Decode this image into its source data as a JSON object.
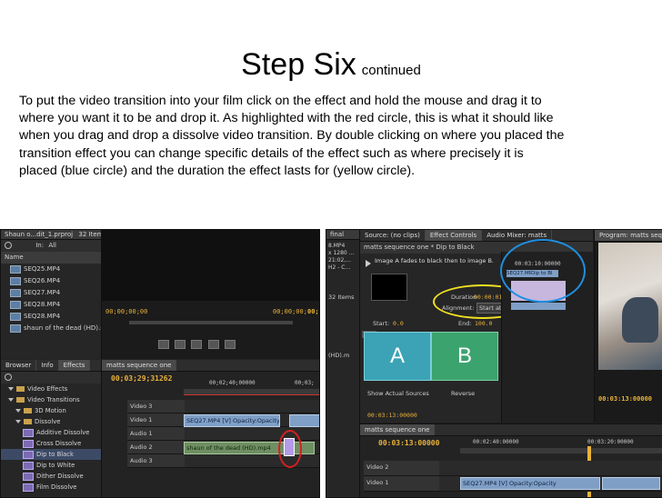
{
  "slide": {
    "title": "Step Six",
    "title_suffix": "continued",
    "body": "To put the video transition into your film click on the effect and hold the mouse and drag it to where you want it to be and drop it. As highlighted with the red circle, this is what it should like when you drag and drop a dissolve video transition. By double clicking on where you placed the transition effect you can change specific details of the effect such as where precisely it is placed (blue circle) and the duration the effect lasts for (yellow circle)."
  },
  "left_shot": {
    "project_title": "Shaun o...dit_1.prproj",
    "project_count": "32 Items",
    "in_label": "In:",
    "in_value": "All",
    "name_header": "Name",
    "clips": [
      "SEQ25.MP4",
      "SEQ26.MP4",
      "SEQ27.MP4",
      "SEQ28.MP4",
      "SEQ28.MP4",
      "shaun of the dead (HD).m"
    ],
    "source_timecode_left": "00;00;00;00",
    "source_timecode_right": "00;00;00;",
    "source_timecode_cut": "00;03",
    "panel_tabs": [
      "Browser",
      "Info",
      "Effects"
    ],
    "effects_tree": [
      {
        "label": "Video Effects",
        "type": "folder",
        "indent": 1
      },
      {
        "label": "Video Transitions",
        "type": "folder",
        "indent": 1
      },
      {
        "label": "3D Motion",
        "type": "folder",
        "indent": 2
      },
      {
        "label": "Dissolve",
        "type": "folder",
        "indent": 2
      },
      {
        "label": "Additive Dissolve",
        "type": "fx",
        "indent": 3
      },
      {
        "label": "Cross Dissolve",
        "type": "fx",
        "indent": 3
      },
      {
        "label": "Dip to Black",
        "type": "fx",
        "indent": 3
      },
      {
        "label": "Dip to White",
        "type": "fx",
        "indent": 3
      },
      {
        "label": "Dither Dissolve",
        "type": "fx",
        "indent": 3
      },
      {
        "label": "Film Dissolve",
        "type": "fx",
        "indent": 3
      }
    ],
    "sequence_tab": "matts sequence one",
    "sequence_timecode": "00;03;29;31262",
    "ruler_time": "00;02;40;00000",
    "ruler_time2": "00;03;",
    "tracks": [
      {
        "name": "Video 3",
        "kind": "video",
        "clip": ""
      },
      {
        "name": "Video 1",
        "kind": "video",
        "clip": "SEQ27.MP4 [V]  Opacity:Opacity"
      },
      {
        "name": "Audio 1",
        "kind": "audio",
        "clip": ""
      },
      {
        "name": "Audio 2",
        "kind": "audio",
        "clip": "shaun of the dead  (HD).mp4"
      },
      {
        "name": "Audio 3",
        "kind": "audio",
        "clip": ""
      }
    ]
  },
  "right_shot": {
    "tabs": [
      "Source: (no clips)",
      "Effect Controls",
      "Audio Mixer: matts"
    ],
    "program_tab": "Program: matts sequ",
    "frag_left": [
      "8.MP4",
      "x 1280 ...",
      "21:02,...",
      "H2 - C..."
    ],
    "frag_left_label": "final",
    "seq_label": "matts sequence one * Dip to Black",
    "transition_desc": "Image A fades to black then to image B.",
    "duration_label": "Duration",
    "duration_value": "00:00:01:13440",
    "alignment_label": "Alignment:",
    "alignment_value": "Start at Cut",
    "start_label": "Start:",
    "start_value": "0.0",
    "end_label": "End:",
    "end_value": "100.0",
    "ec_timecode": "00:03:10:00000",
    "ec_clip": "SEQ27.MP4",
    "ec_dip": "Dip to Bl",
    "a_label": "A",
    "b_label": "B",
    "show_sources": "Show Actual Sources",
    "reverse": "Reverse",
    "bottom_timecode": "00:03:13:00000",
    "program_timecode": "00:03:13:00000",
    "items_count": "32 Items",
    "hd_label": "(HD).m",
    "seq_tab": "matts sequence one",
    "seq_timecode": "00:03:13:00000",
    "ruler1": "00:02:40:00000",
    "ruler2": "00:03:20:00000",
    "tracks": [
      {
        "name": "Video 2",
        "clip": ""
      },
      {
        "name": "Video 1",
        "clip": "SEQ27.MP4 [V] Opacity:Opacity"
      }
    ]
  },
  "colors": {
    "accent_timecode": "#e8b23a",
    "red_circle": "#d42020",
    "blue_circle": "#1f8fe0",
    "yellow_circle": "#f0e020",
    "a_tile": "#3ba3b5",
    "b_tile": "#3ba36e"
  }
}
